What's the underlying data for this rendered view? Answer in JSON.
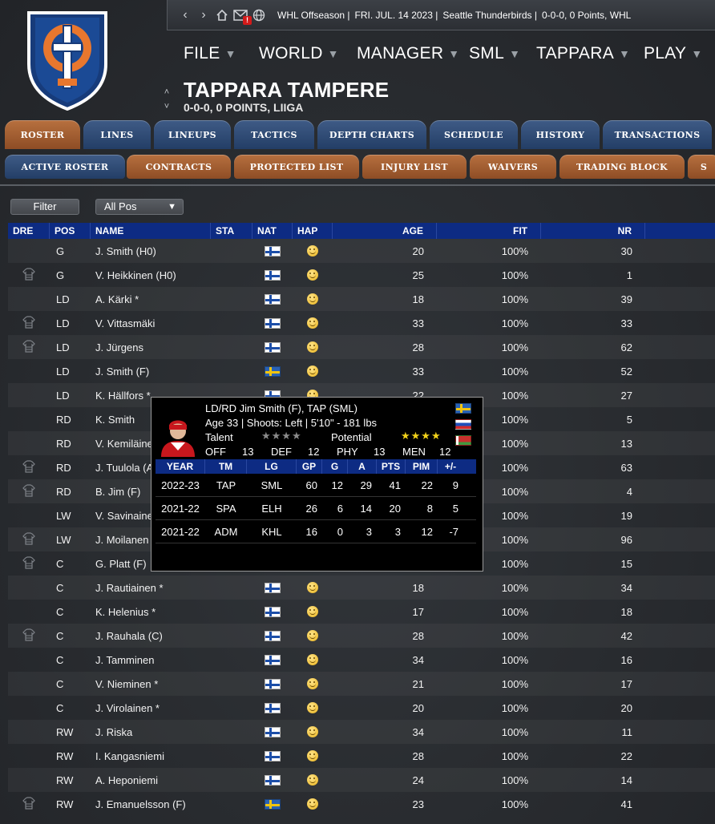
{
  "status_bar": {
    "league_state": "WHL Offseason |",
    "date": "FRI. JUL. 14 2023 |",
    "team_info": "Seattle Thunderbirds |",
    "record": "0-0-0, 0 Points, WHL",
    "mail_badge": "!"
  },
  "menu": {
    "items": [
      {
        "label": "FILE"
      },
      {
        "label": "WORLD"
      },
      {
        "label": "MANAGER"
      },
      {
        "label": "SML"
      },
      {
        "label": "TAPPARA"
      },
      {
        "label": "PLAY"
      }
    ]
  },
  "team": {
    "name": "TAPPARA TAMPERE",
    "record": "0-0-0, 0 POINTS, LIIGA"
  },
  "tabs_primary": [
    "ROSTER",
    "LINES",
    "LINEUPS",
    "TACTICS",
    "DEPTH CHARTS",
    "SCHEDULE",
    "HISTORY",
    "TRANSACTIONS"
  ],
  "tabs_secondary": [
    "ACTIVE ROSTER",
    "CONTRACTS",
    "PROTECTED LIST",
    "INJURY LIST",
    "WAIVERS",
    "TRADING BLOCK",
    "S"
  ],
  "active_primary_tab": "ROSTER",
  "active_secondary_tab": "ACTIVE ROSTER",
  "filter": {
    "button_label": "Filter",
    "position_value": "All Pos"
  },
  "roster": {
    "columns": [
      "DRE",
      "POS",
      "NAME",
      "STA",
      "NAT",
      "HAP",
      "AGE",
      "FIT",
      "NR"
    ],
    "rows": [
      {
        "dre": false,
        "pos": "G",
        "name": "J. Smith (H0)",
        "nat": "fin",
        "hap": true,
        "age": "20",
        "fit": "100%",
        "nr": "30"
      },
      {
        "dre": true,
        "pos": "G",
        "name": "V. Heikkinen (H0)",
        "nat": "fin",
        "hap": true,
        "age": "25",
        "fit": "100%",
        "nr": "1"
      },
      {
        "dre": false,
        "pos": "LD",
        "name": "A. Kärki *",
        "nat": "fin",
        "hap": true,
        "age": "18",
        "fit": "100%",
        "nr": "39"
      },
      {
        "dre": true,
        "pos": "LD",
        "name": "V. Vittasmäki",
        "nat": "fin",
        "hap": true,
        "age": "33",
        "fit": "100%",
        "nr": "33"
      },
      {
        "dre": true,
        "pos": "LD",
        "name": "J. Jürgens",
        "nat": "fin",
        "hap": true,
        "age": "28",
        "fit": "100%",
        "nr": "62"
      },
      {
        "dre": false,
        "pos": "LD",
        "name": "J. Smith (F)",
        "nat": "swe",
        "hap": true,
        "age": "33",
        "fit": "100%",
        "nr": "52"
      },
      {
        "dre": false,
        "pos": "LD",
        "name": "K. Hällfors *",
        "nat": "fin",
        "hap": true,
        "age": "22",
        "fit": "100%",
        "nr": "27"
      },
      {
        "dre": false,
        "pos": "RD",
        "name": "K. Smith",
        "nat": "",
        "hap": false,
        "age": "",
        "fit": "100%",
        "nr": "5"
      },
      {
        "dre": false,
        "pos": "RD",
        "name": "V. Kemiläinen",
        "nat": "",
        "hap": false,
        "age": "",
        "fit": "100%",
        "nr": "13"
      },
      {
        "dre": true,
        "pos": "RD",
        "name": "J. Tuulola (A)",
        "nat": "",
        "hap": false,
        "age": "",
        "fit": "100%",
        "nr": "63"
      },
      {
        "dre": true,
        "pos": "RD",
        "name": "B. Jim (F)",
        "nat": "",
        "hap": false,
        "age": "",
        "fit": "100%",
        "nr": "4"
      },
      {
        "dre": false,
        "pos": "LW",
        "name": "V. Savinainen",
        "nat": "",
        "hap": false,
        "age": "",
        "fit": "100%",
        "nr": "19"
      },
      {
        "dre": true,
        "pos": "LW",
        "name": "J. Moilanen",
        "nat": "",
        "hap": false,
        "age": "",
        "fit": "100%",
        "nr": "96"
      },
      {
        "dre": true,
        "pos": "C",
        "name": "G. Platt (F)",
        "nat": "",
        "hap": false,
        "age": "",
        "fit": "100%",
        "nr": "15"
      },
      {
        "dre": false,
        "pos": "C",
        "name": "J. Rautiainen *",
        "nat": "fin",
        "hap": true,
        "age": "18",
        "fit": "100%",
        "nr": "34"
      },
      {
        "dre": false,
        "pos": "C",
        "name": "K. Helenius *",
        "nat": "fin",
        "hap": true,
        "age": "17",
        "fit": "100%",
        "nr": "18"
      },
      {
        "dre": true,
        "pos": "C",
        "name": "J. Rauhala (C)",
        "nat": "fin",
        "hap": true,
        "age": "28",
        "fit": "100%",
        "nr": "42"
      },
      {
        "dre": false,
        "pos": "C",
        "name": "J. Tamminen",
        "nat": "fin",
        "hap": true,
        "age": "34",
        "fit": "100%",
        "nr": "16"
      },
      {
        "dre": false,
        "pos": "C",
        "name": "V. Nieminen *",
        "nat": "fin",
        "hap": true,
        "age": "21",
        "fit": "100%",
        "nr": "17"
      },
      {
        "dre": false,
        "pos": "C",
        "name": "J. Virolainen *",
        "nat": "fin",
        "hap": true,
        "age": "20",
        "fit": "100%",
        "nr": "20"
      },
      {
        "dre": false,
        "pos": "RW",
        "name": "J. Riska",
        "nat": "fin",
        "hap": true,
        "age": "34",
        "fit": "100%",
        "nr": "11"
      },
      {
        "dre": false,
        "pos": "RW",
        "name": "I. Kangasniemi",
        "nat": "fin",
        "hap": true,
        "age": "28",
        "fit": "100%",
        "nr": "22"
      },
      {
        "dre": false,
        "pos": "RW",
        "name": "A. Heponiemi",
        "nat": "fin",
        "hap": true,
        "age": "24",
        "fit": "100%",
        "nr": "14"
      },
      {
        "dre": true,
        "pos": "RW",
        "name": "J. Emanuelsson (F)",
        "nat": "swe",
        "hap": true,
        "age": "23",
        "fit": "100%",
        "nr": "41"
      }
    ]
  },
  "tooltip": {
    "title": "LD/RD Jim Smith  (F), TAP (SML)",
    "details": "Age 33 | Shoots: Left | 5'10\" - 181 lbs",
    "talent_label": "Talent",
    "talent_stars": "★★★★",
    "potential_label": "Potential",
    "potential_stars": "★★★★",
    "attrs": [
      {
        "label": "OFF",
        "value": "13"
      },
      {
        "label": "DEF",
        "value": "12"
      },
      {
        "label": "PHY",
        "value": "13"
      },
      {
        "label": "MEN",
        "value": "12"
      }
    ],
    "flags": [
      "swe",
      "rus",
      "blr"
    ],
    "stats_columns": [
      "YEAR",
      "TM",
      "LG",
      "GP",
      "G",
      "A",
      "PTS",
      "PIM",
      "+/-"
    ],
    "stats": [
      {
        "year": "2022-23",
        "tm": "TAP",
        "lg": "SML",
        "gp": "60",
        "g": "12",
        "a": "29",
        "pts": "41",
        "pim": "22",
        "pm": "9"
      },
      {
        "year": "2021-22",
        "tm": "SPA",
        "lg": "ELH",
        "gp": "26",
        "g": "6",
        "a": "14",
        "pts": "20",
        "pim": "8",
        "pm": "5"
      },
      {
        "year": "2021-22",
        "tm": "ADM",
        "lg": "KHL",
        "gp": "16",
        "g": "0",
        "a": "3",
        "pts": "3",
        "pim": "12",
        "pm": "-7"
      }
    ]
  },
  "colors": {
    "primary_tab_active": "#b7703f",
    "tab_blue": "#233e66",
    "table_header": "#0d2b83",
    "accent_orange": "#e8772e"
  }
}
